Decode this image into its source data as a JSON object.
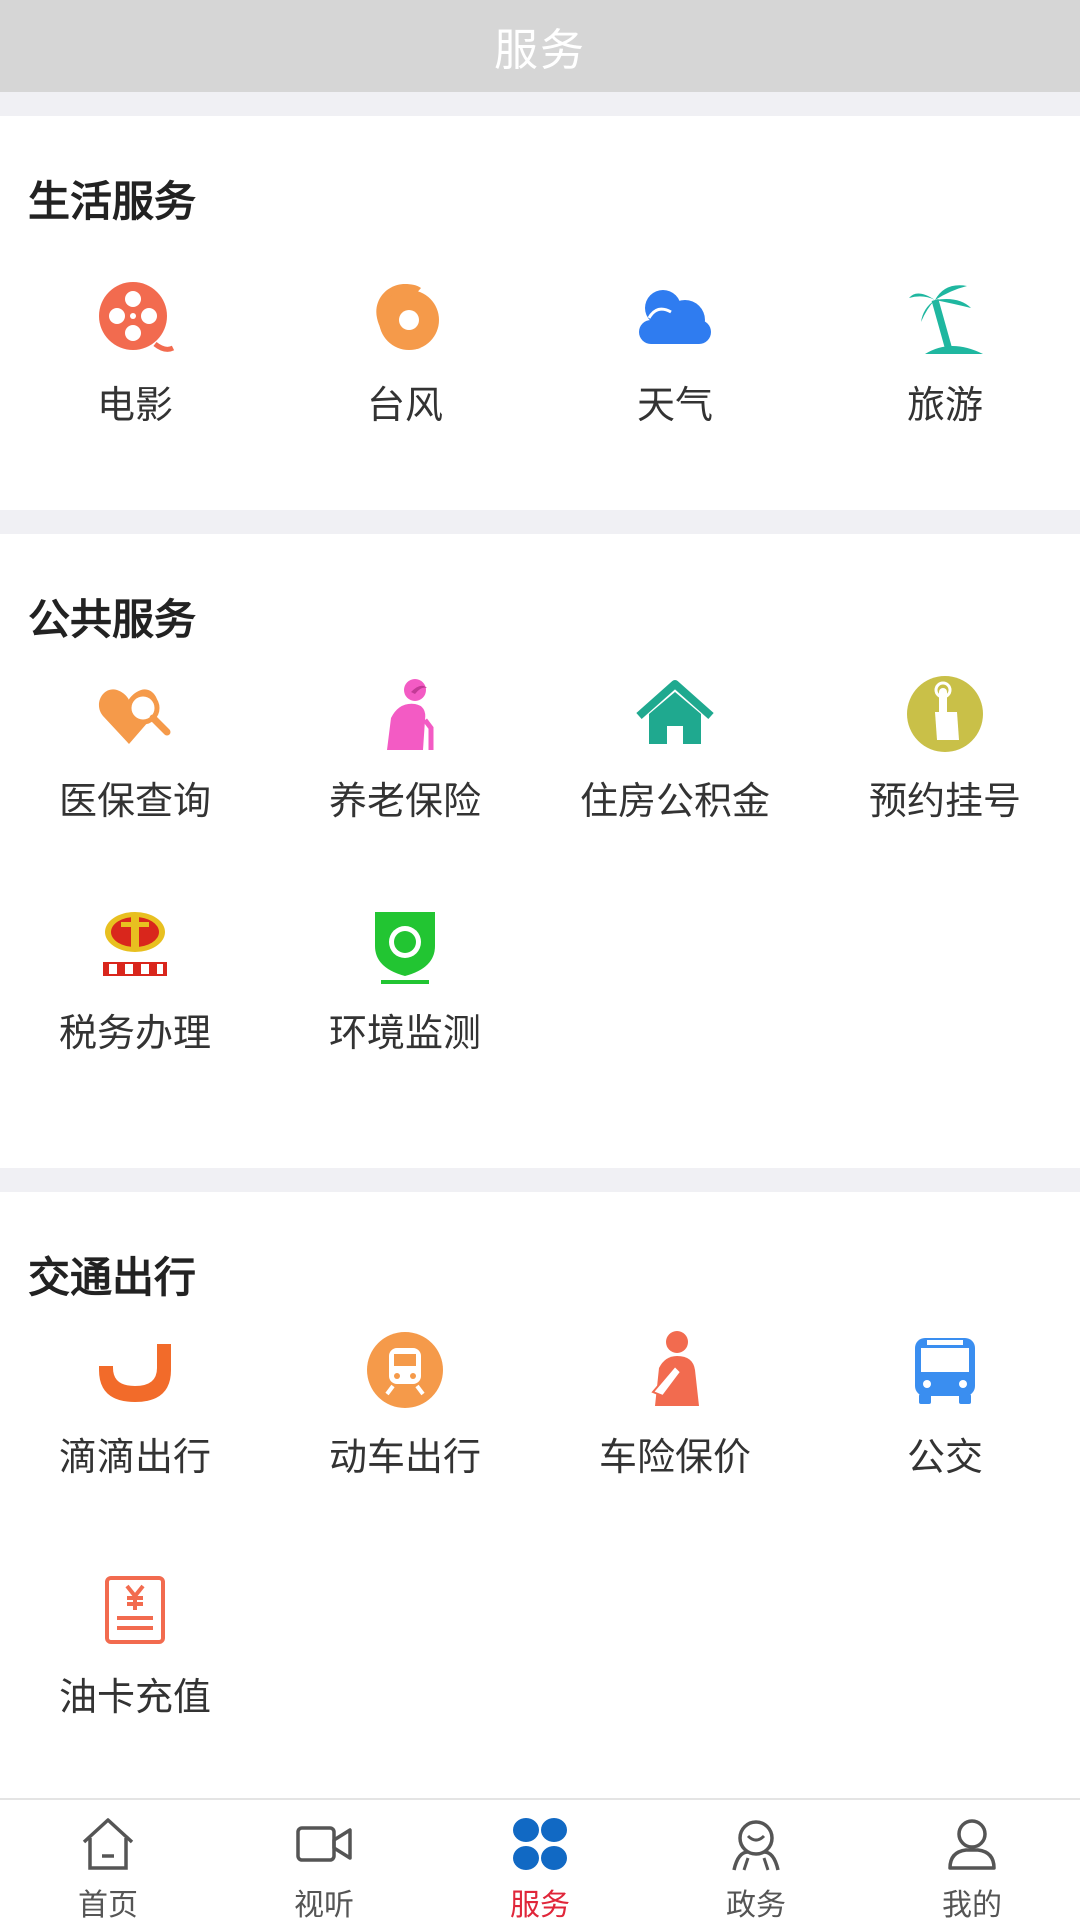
{
  "header": {
    "title": "服务"
  },
  "sections": [
    {
      "title": "生活服务",
      "items": [
        {
          "label": "电影",
          "icon": "film-reel-icon",
          "color": "#f26b4f"
        },
        {
          "label": "台风",
          "icon": "typhoon-icon",
          "color": "#f59a4a"
        },
        {
          "label": "天气",
          "icon": "cloud-icon",
          "color": "#2f7cf0"
        },
        {
          "label": "旅游",
          "icon": "palm-tree-icon",
          "color": "#1fb7a0"
        }
      ]
    },
    {
      "title": "公共服务",
      "items": [
        {
          "label": "医保查询",
          "icon": "heart-search-icon",
          "color": "#f59a4a"
        },
        {
          "label": "养老保险",
          "icon": "elder-icon",
          "color": "#f35bc4"
        },
        {
          "label": "住房公积金",
          "icon": "house-icon",
          "color": "#1fa98f"
        },
        {
          "label": "预约挂号",
          "icon": "tap-finger-icon",
          "color": "#c9c048"
        },
        {
          "label": "税务办理",
          "icon": "tax-emblem-icon",
          "color": "#d9261c"
        },
        {
          "label": "环境监测",
          "icon": "environment-badge-icon",
          "color": "#22c532"
        }
      ]
    },
    {
      "title": "交通出行",
      "items": [
        {
          "label": "滴滴出行",
          "icon": "didi-logo-icon",
          "color": "#f26b2a"
        },
        {
          "label": "动车出行",
          "icon": "train-icon",
          "color": "#f59a4a"
        },
        {
          "label": "车险保价",
          "icon": "injured-person-icon",
          "color": "#f26b4f"
        },
        {
          "label": "公交",
          "icon": "bus-icon",
          "color": "#3a8ef0"
        },
        {
          "label": "油卡充值",
          "icon": "yuan-receipt-icon",
          "color": "#f26b4f"
        }
      ]
    }
  ],
  "bottom_nav": {
    "active_color": "#e0263a",
    "items": [
      {
        "label": "首页",
        "icon": "home-icon"
      },
      {
        "label": "视听",
        "icon": "video-icon"
      },
      {
        "label": "服务",
        "icon": "grid-dots-icon",
        "active": true
      },
      {
        "label": "政务",
        "icon": "government-icon"
      },
      {
        "label": "我的",
        "icon": "user-icon"
      }
    ]
  }
}
